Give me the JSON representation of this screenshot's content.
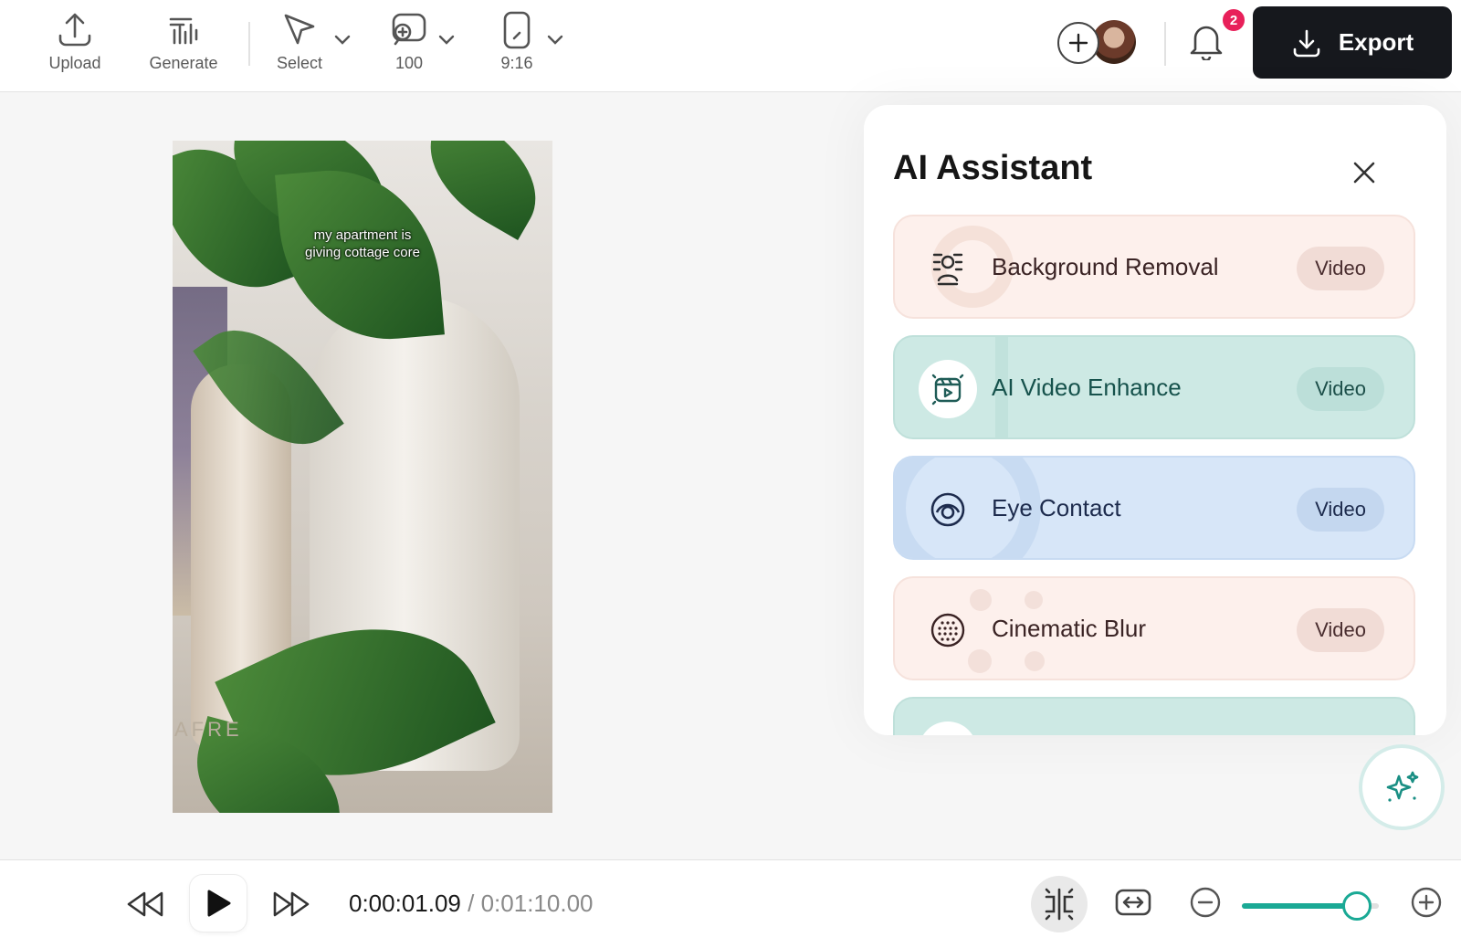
{
  "toolbar": {
    "upload_label": "Upload",
    "generate_label": "Generate",
    "select_label": "Select",
    "zoom_label": "100",
    "aspect_label": "9:16",
    "notification_count": "2",
    "export_label": "Export"
  },
  "video": {
    "caption_line1": "my apartment is",
    "caption_line2": "giving cottage core",
    "etched_text": "AFRE"
  },
  "ai_panel": {
    "title": "AI Assistant",
    "cards": [
      {
        "label": "Background Removal",
        "tag": "Video",
        "bg": "#fdf0ec",
        "icon": "background-removal-icon"
      },
      {
        "label": "AI Video Enhance",
        "tag": "Video",
        "bg": "#cde9e4",
        "icon": "video-enhance-icon"
      },
      {
        "label": "Eye Contact",
        "tag": "Video",
        "bg": "#d7e6f8",
        "icon": "eye-contact-icon"
      },
      {
        "label": "Cinematic Blur",
        "tag": "Video",
        "bg": "#fdf0ec",
        "icon": "cinematic-blur-icon"
      }
    ]
  },
  "player": {
    "current_time": "0:00:01.09",
    "separator": "/",
    "total_time": "0:01:10.00",
    "zoom_fraction": 0.84
  },
  "colors": {
    "accent": "#1aa995",
    "export_bg": "#16181d",
    "badge": "#e8205a"
  }
}
